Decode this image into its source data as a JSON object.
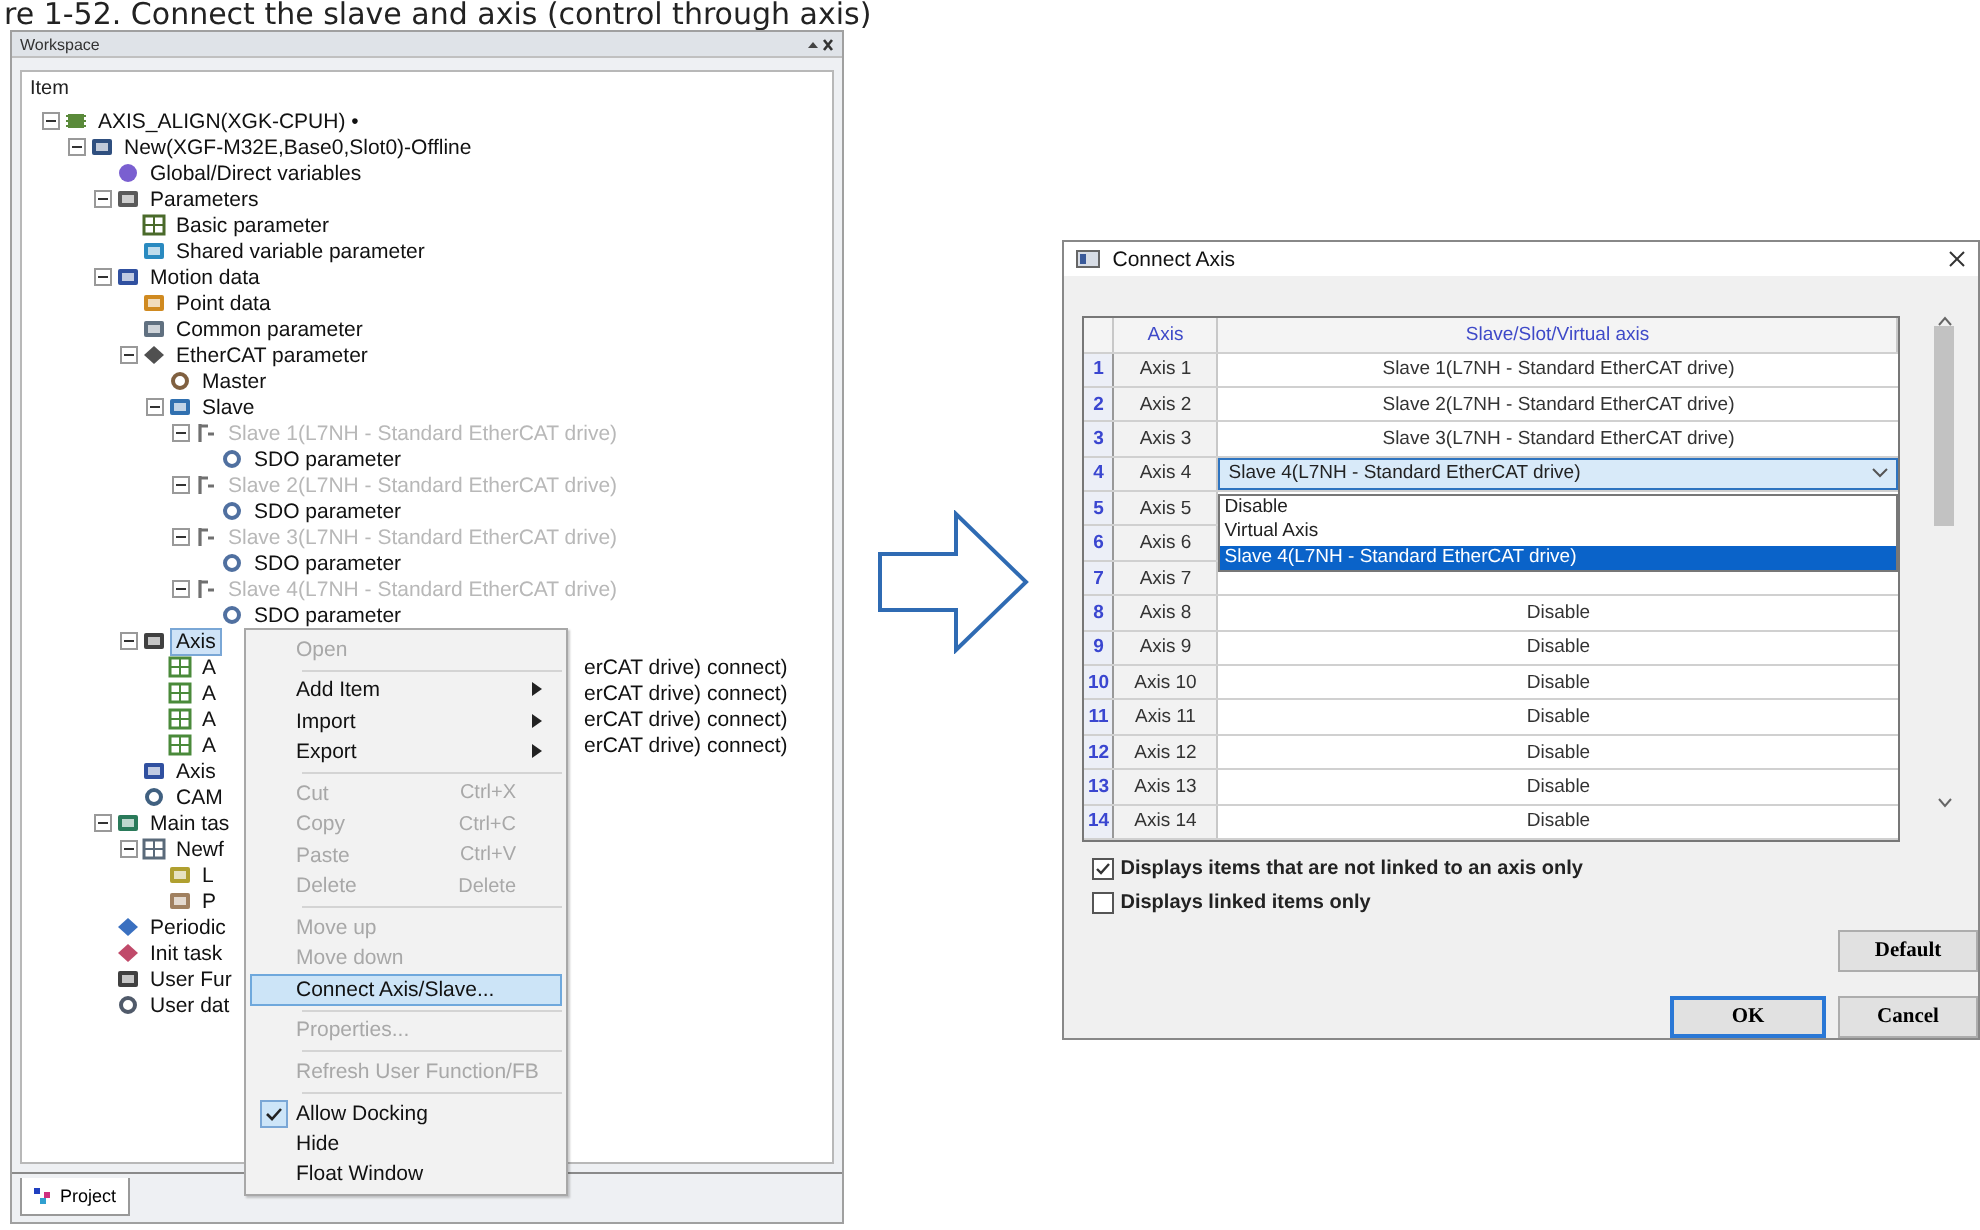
{
  "caption": "re 1-52. Connect the slave and axis (control through axis)",
  "workspace": {
    "title": "Workspace",
    "column_header": "Item",
    "tree": [
      {
        "label": "AXIS_ALIGN(XGK-CPUH) •",
        "kind": "cpu",
        "expanded": true,
        "selected": false,
        "disabled": false,
        "children": [
          {
            "label": "New(XGF-M32E,Base0,Slot0)-Offline",
            "kind": "module",
            "expanded": true,
            "selected": false,
            "disabled": false,
            "children": [
              {
                "label": "Global/Direct variables",
                "kind": "variables",
                "selected": false,
                "disabled": false
              },
              {
                "label": "Parameters",
                "kind": "folder",
                "expanded": true,
                "selected": false,
                "disabled": false,
                "children": [
                  {
                    "label": "Basic parameter",
                    "kind": "param",
                    "selected": false,
                    "disabled": false
                  },
                  {
                    "label": "Shared variable parameter",
                    "kind": "shared",
                    "selected": false,
                    "disabled": false
                  }
                ]
              },
              {
                "label": "Motion data",
                "kind": "motion",
                "expanded": true,
                "selected": false,
                "disabled": false,
                "children": [
                  {
                    "label": "Point data",
                    "kind": "point",
                    "selected": false,
                    "disabled": false
                  },
                  {
                    "label": "Common parameter",
                    "kind": "common",
                    "selected": false,
                    "disabled": false
                  },
                  {
                    "label": "EtherCAT parameter",
                    "kind": "ethercat",
                    "expanded": true,
                    "selected": false,
                    "disabled": false,
                    "children": [
                      {
                        "label": "Master",
                        "kind": "master",
                        "selected": false,
                        "disabled": false
                      },
                      {
                        "label": "Slave",
                        "kind": "slave",
                        "expanded": true,
                        "selected": false,
                        "disabled": false,
                        "children": [
                          {
                            "label": "Slave  1(L7NH - Standard EtherCAT drive)",
                            "kind": "drive",
                            "expanded": true,
                            "selected": false,
                            "disabled": true,
                            "children": [
                              {
                                "label": "SDO parameter",
                                "kind": "sdo",
                                "selected": false,
                                "disabled": false
                              }
                            ]
                          },
                          {
                            "label": "Slave  2(L7NH - Standard EtherCAT drive)",
                            "kind": "drive",
                            "expanded": true,
                            "selected": false,
                            "disabled": true,
                            "children": [
                              {
                                "label": "SDO parameter",
                                "kind": "sdo",
                                "selected": false,
                                "disabled": false
                              }
                            ]
                          },
                          {
                            "label": "Slave  3(L7NH - Standard EtherCAT drive)",
                            "kind": "drive",
                            "expanded": true,
                            "selected": false,
                            "disabled": true,
                            "children": [
                              {
                                "label": "SDO parameter",
                                "kind": "sdo",
                                "selected": false,
                                "disabled": false
                              }
                            ]
                          },
                          {
                            "label": "Slave  4(L7NH - Standard EtherCAT drive)",
                            "kind": "drive",
                            "expanded": true,
                            "selected": false,
                            "disabled": true,
                            "children": [
                              {
                                "label": "SDO parameter",
                                "kind": "sdo",
                                "selected": false,
                                "disabled": false
                              }
                            ]
                          }
                        ]
                      }
                    ]
                  },
                  {
                    "label": "Axis",
                    "kind": "axis",
                    "expanded": true,
                    "selected": true,
                    "disabled": false,
                    "children": [
                      {
                        "label": "A",
                        "tail": "erCAT drive) connect)",
                        "kind": "axis_item",
                        "selected": false,
                        "disabled": false
                      },
                      {
                        "label": "A",
                        "tail": "erCAT drive) connect)",
                        "kind": "axis_item",
                        "selected": false,
                        "disabled": false
                      },
                      {
                        "label": "A",
                        "tail": "erCAT drive) connect)",
                        "kind": "axis_item",
                        "selected": false,
                        "disabled": false
                      },
                      {
                        "label": "A",
                        "tail": "erCAT drive) connect)",
                        "kind": "axis_item",
                        "selected": false,
                        "disabled": false
                      }
                    ]
                  },
                  {
                    "label": "Axis",
                    "kind": "axis_common",
                    "selected": false,
                    "disabled": false
                  },
                  {
                    "label": "CAM",
                    "kind": "cam",
                    "selected": false,
                    "disabled": false
                  }
                ]
              },
              {
                "label": "Main tas",
                "kind": "task",
                "expanded": true,
                "selected": false,
                "disabled": false,
                "children": [
                  {
                    "label": "Newf",
                    "kind": "program",
                    "expanded": true,
                    "selected": false,
                    "disabled": false,
                    "children": [
                      {
                        "label": "L",
                        "kind": "ladder",
                        "selected": false,
                        "disabled": false
                      },
                      {
                        "label": "P",
                        "kind": "local",
                        "selected": false,
                        "disabled": false
                      }
                    ]
                  }
                ]
              },
              {
                "label": "Periodic",
                "kind": "periodic",
                "selected": false,
                "disabled": false
              },
              {
                "label": "Init task",
                "kind": "init",
                "selected": false,
                "disabled": false
              },
              {
                "label": "User Fur",
                "kind": "user_function",
                "selected": false,
                "disabled": false
              },
              {
                "label": "User dat",
                "kind": "user_data",
                "selected": false,
                "disabled": false
              }
            ]
          }
        ]
      }
    ],
    "context_menu": {
      "items": [
        {
          "kind": "command",
          "label": "Open",
          "disabled": true,
          "selected": false,
          "checked": false,
          "submenu": false
        },
        {
          "kind": "separator"
        },
        {
          "kind": "command",
          "label": "Add Item",
          "disabled": false,
          "selected": false,
          "checked": false,
          "submenu": true
        },
        {
          "kind": "command",
          "label": "Import",
          "disabled": false,
          "selected": false,
          "checked": false,
          "submenu": true
        },
        {
          "kind": "command",
          "label": "Export",
          "disabled": false,
          "selected": false,
          "checked": false,
          "submenu": true
        },
        {
          "kind": "separator"
        },
        {
          "kind": "command",
          "label": "Cut",
          "shortcut": "Ctrl+X",
          "disabled": true,
          "selected": false,
          "checked": false,
          "submenu": false
        },
        {
          "kind": "command",
          "label": "Copy",
          "shortcut": "Ctrl+C",
          "disabled": true,
          "selected": false,
          "checked": false,
          "submenu": false
        },
        {
          "kind": "command",
          "label": "Paste",
          "shortcut": "Ctrl+V",
          "disabled": true,
          "selected": false,
          "checked": false,
          "submenu": false
        },
        {
          "kind": "command",
          "label": "Delete",
          "shortcut": "Delete",
          "disabled": true,
          "selected": false,
          "checked": false,
          "submenu": false
        },
        {
          "kind": "separator"
        },
        {
          "kind": "command",
          "label": "Move up",
          "disabled": true,
          "selected": false,
          "checked": false,
          "submenu": false
        },
        {
          "kind": "command",
          "label": "Move down",
          "disabled": true,
          "selected": false,
          "checked": false,
          "submenu": false
        },
        {
          "kind": "command",
          "label": "Connect Axis/Slave...",
          "disabled": false,
          "selected": true,
          "checked": false,
          "submenu": false
        },
        {
          "kind": "separator"
        },
        {
          "kind": "command",
          "label": "Properties...",
          "disabled": true,
          "selected": false,
          "checked": false,
          "submenu": false
        },
        {
          "kind": "separator"
        },
        {
          "kind": "command",
          "label": "Refresh User Function/FB",
          "disabled": true,
          "selected": false,
          "checked": false,
          "submenu": false
        },
        {
          "kind": "separator"
        },
        {
          "kind": "command",
          "label": "Allow Docking",
          "disabled": false,
          "selected": false,
          "checked": true,
          "submenu": false
        },
        {
          "kind": "command",
          "label": "Hide",
          "disabled": false,
          "selected": false,
          "checked": false,
          "submenu": false
        },
        {
          "kind": "command",
          "label": "Float Window",
          "disabled": false,
          "selected": false,
          "checked": false,
          "submenu": false
        }
      ]
    },
    "bottom_tabs": [
      {
        "label": "Project",
        "selected": true
      }
    ]
  },
  "dialog": {
    "title": "Connect Axis",
    "columns": [
      "Axis",
      "Slave/Slot/Virtual axis"
    ],
    "rows": [
      {
        "number": "1",
        "axis": "Axis 1",
        "kind": "text",
        "slave": "Slave 1(L7NH - Standard EtherCAT drive)"
      },
      {
        "number": "2",
        "axis": "Axis 2",
        "kind": "text",
        "slave": "Slave 2(L7NH - Standard EtherCAT drive)"
      },
      {
        "number": "3",
        "axis": "Axis 3",
        "kind": "text",
        "slave": "Slave 3(L7NH - Standard EtherCAT drive)"
      },
      {
        "number": "4",
        "axis": "Axis 4",
        "kind": "combo",
        "slave": "Slave 4(L7NH - Standard EtherCAT drive)",
        "options": [
          {
            "label": "Disable",
            "selected": false
          },
          {
            "label": "Virtual Axis",
            "selected": false
          },
          {
            "label": "Slave 4(L7NH - Standard EtherCAT drive)",
            "selected": true
          }
        ]
      },
      {
        "number": "5",
        "axis": "Axis 5",
        "kind": "text"
      },
      {
        "number": "6",
        "axis": "Axis 6",
        "kind": "text"
      },
      {
        "number": "7",
        "axis": "Axis 7",
        "kind": "text"
      },
      {
        "number": "8",
        "axis": "Axis 8",
        "kind": "text",
        "slave": "Disable"
      },
      {
        "number": "9",
        "axis": "Axis 9",
        "kind": "text",
        "slave": "Disable"
      },
      {
        "number": "10",
        "axis": "Axis 10",
        "kind": "text",
        "slave": "Disable"
      },
      {
        "number": "11",
        "axis": "Axis 11",
        "kind": "text",
        "slave": "Disable"
      },
      {
        "number": "12",
        "axis": "Axis 12",
        "kind": "text",
        "slave": "Disable"
      },
      {
        "number": "13",
        "axis": "Axis 13",
        "kind": "text",
        "slave": "Disable"
      },
      {
        "number": "14",
        "axis": "Axis 14",
        "kind": "text",
        "slave": "Disable"
      }
    ],
    "checkboxes": [
      {
        "label": "Displays items that are not linked to an axis only",
        "checked": true
      },
      {
        "label": "Displays linked items only",
        "checked": false
      }
    ],
    "buttons": [
      {
        "label": "Default",
        "default": false
      },
      {
        "label": "OK",
        "default": true
      },
      {
        "label": "Cancel",
        "default": false
      }
    ]
  }
}
